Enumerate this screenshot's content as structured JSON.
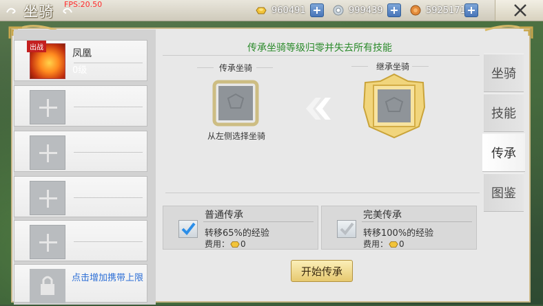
{
  "header": {
    "title": "坐骑",
    "fps": "FPS:20.50",
    "resources": [
      {
        "icon": "gold-ingot-icon",
        "value": "960491"
      },
      {
        "icon": "silver-coin-icon",
        "value": "999439"
      },
      {
        "icon": "copper-coin-icon",
        "value": "5925171"
      }
    ]
  },
  "mount_list": {
    "items": [
      {
        "badge": "出战",
        "name": "凤凰",
        "level": "0级"
      }
    ],
    "empty_slots": 4,
    "unlock_text": "点击增加携带上限"
  },
  "inherit": {
    "headline": "传承坐骑等级归零并失去所有技能",
    "source_label": "传承坐骑",
    "target_label": "继承坐骑",
    "hint": "从左侧选择坐骑"
  },
  "options": [
    {
      "title": "普通传承",
      "desc": "转移65%的经验",
      "cost_label": "费用：",
      "cost": "0",
      "checked": true
    },
    {
      "title": "完美传承",
      "desc": "转移100%的经验",
      "cost_label": "费用：",
      "cost": "0",
      "checked": false
    }
  ],
  "start_button": "开始传承",
  "tabs": [
    {
      "label": "坐骑",
      "active": false
    },
    {
      "label": "技能",
      "active": false
    },
    {
      "label": "传承",
      "active": true
    },
    {
      "label": "图鉴",
      "active": false
    }
  ],
  "colors": {
    "headline": "#2a8a2a",
    "link": "#2d6fd6",
    "fps": "#ff2a2a",
    "badge": "#c42020"
  }
}
